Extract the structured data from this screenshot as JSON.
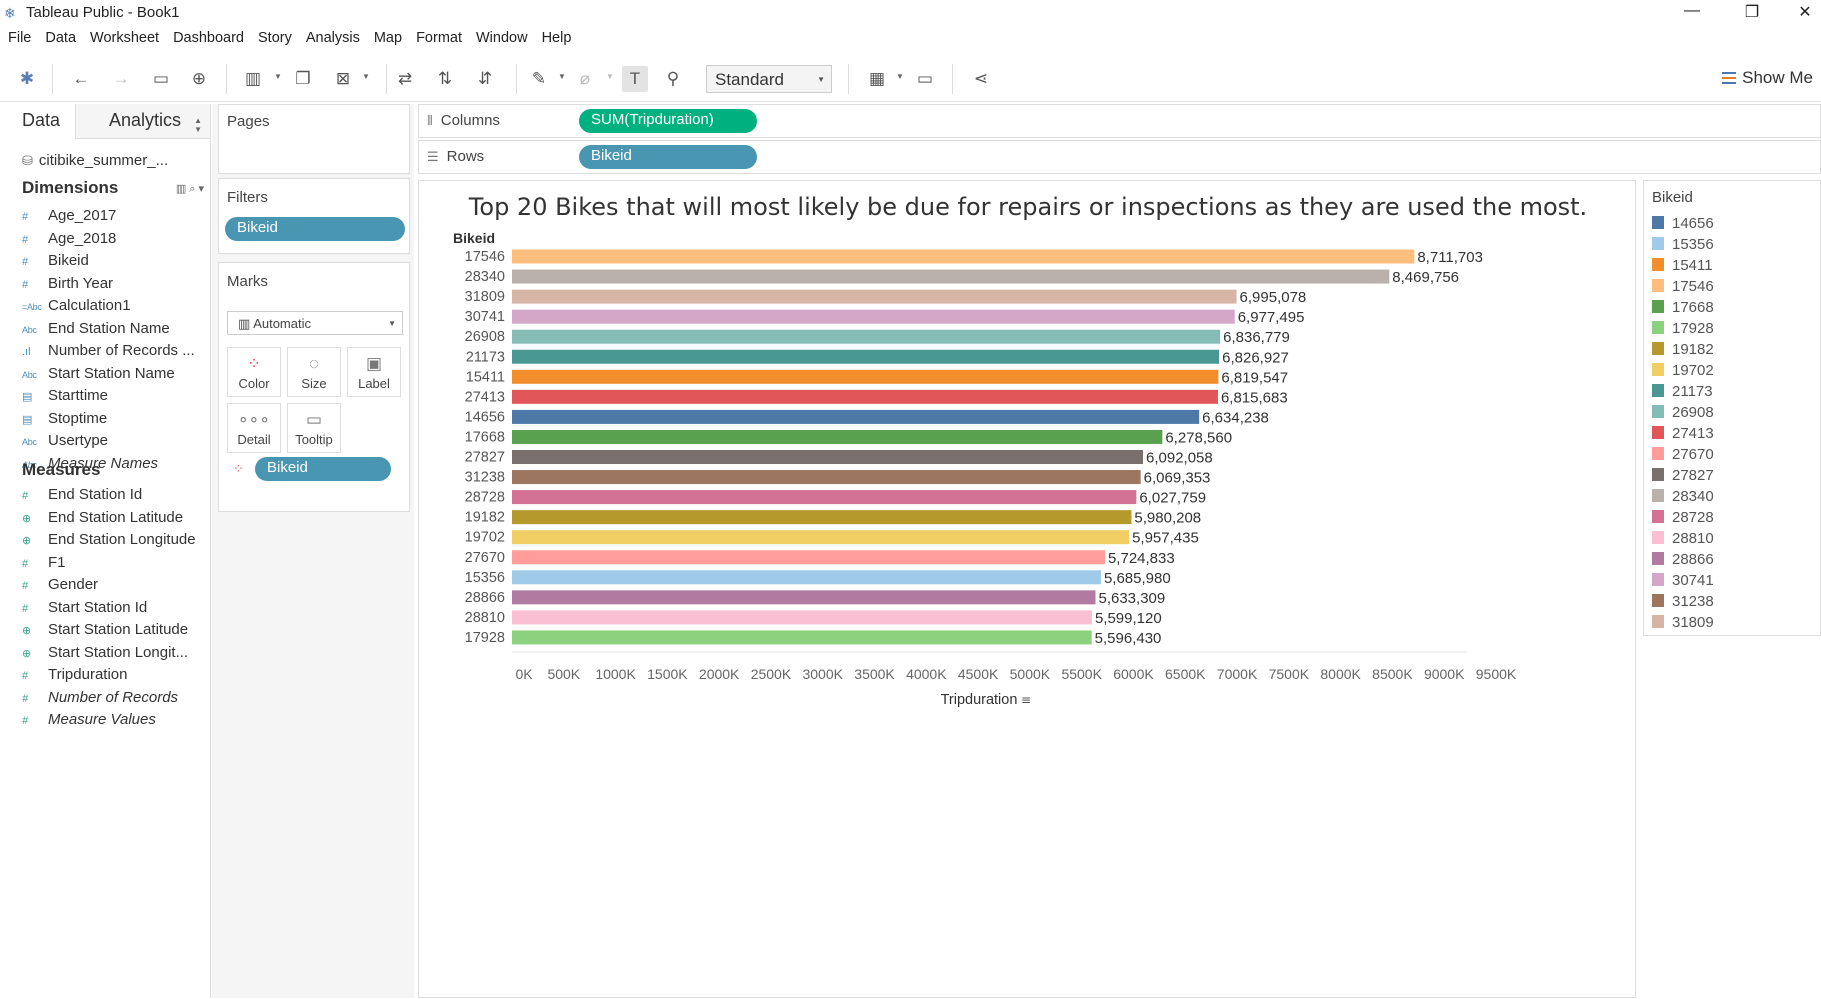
{
  "window": {
    "title": "Tableau Public - Book1",
    "minimize": "—",
    "restore": "❐",
    "close": "✕"
  },
  "menu": [
    "File",
    "Data",
    "Worksheet",
    "Dashboard",
    "Story",
    "Analysis",
    "Map",
    "Format",
    "Window",
    "Help"
  ],
  "toolbar": {
    "fit_mode": "Standard",
    "show_me": "Show Me"
  },
  "data_pane": {
    "tabs": [
      "Data",
      "Analytics"
    ],
    "data_source": "citibike_summer_...",
    "dimensions_label": "Dimensions",
    "dimensions": [
      {
        "name": "Age_2017",
        "icon": "number-dim"
      },
      {
        "name": "Age_2018",
        "icon": "number-dim"
      },
      {
        "name": "Bikeid",
        "icon": "number-dim"
      },
      {
        "name": "Birth Year",
        "icon": "number-dim"
      },
      {
        "name": "Calculation1",
        "icon": "calc-string"
      },
      {
        "name": "End Station Name",
        "icon": "string"
      },
      {
        "name": "Number of Records ...",
        "icon": "bar-dim"
      },
      {
        "name": "Start Station Name",
        "icon": "string"
      },
      {
        "name": "Starttime",
        "icon": "date"
      },
      {
        "name": "Stoptime",
        "icon": "date"
      },
      {
        "name": "Usertype",
        "icon": "string"
      },
      {
        "name": "Measure Names",
        "icon": "string",
        "italic": true
      }
    ],
    "measures_label": "Measures",
    "measures": [
      {
        "name": "End Station Id",
        "icon": "number"
      },
      {
        "name": "End Station Latitude",
        "icon": "geo"
      },
      {
        "name": "End Station Longitude",
        "icon": "geo"
      },
      {
        "name": "F1",
        "icon": "number"
      },
      {
        "name": "Gender",
        "icon": "number"
      },
      {
        "name": "Start Station Id",
        "icon": "number"
      },
      {
        "name": "Start Station Latitude",
        "icon": "geo"
      },
      {
        "name": "Start Station Longit...",
        "icon": "geo"
      },
      {
        "name": "Tripduration",
        "icon": "number"
      },
      {
        "name": "Number of Records",
        "icon": "number",
        "italic": true
      },
      {
        "name": "Measure Values",
        "icon": "number",
        "italic": true
      }
    ]
  },
  "shelves": {
    "pages_label": "Pages",
    "filters_label": "Filters",
    "filter_pill": "Bikeid",
    "marks_label": "Marks",
    "mark_type": "Automatic",
    "mark_buttons": [
      "Color",
      "Size",
      "Label",
      "Detail",
      "Tooltip"
    ],
    "marks_pill": "Bikeid",
    "columns_label": "Columns",
    "columns_pill": "SUM(Tripduration)",
    "rows_label": "Rows",
    "rows_pill": "Bikeid"
  },
  "legend": {
    "title": "Bikeid",
    "items": [
      {
        "label": "14656",
        "color": "#4e79a7"
      },
      {
        "label": "15356",
        "color": "#a0cbe8"
      },
      {
        "label": "15411",
        "color": "#f28e2b"
      },
      {
        "label": "17546",
        "color": "#ffbe7d"
      },
      {
        "label": "17668",
        "color": "#59a14f"
      },
      {
        "label": "17928",
        "color": "#8cd17d"
      },
      {
        "label": "19182",
        "color": "#b6992d"
      },
      {
        "label": "19702",
        "color": "#f1ce63"
      },
      {
        "label": "21173",
        "color": "#499894"
      },
      {
        "label": "26908",
        "color": "#86bcb6"
      },
      {
        "label": "27413",
        "color": "#e15759"
      },
      {
        "label": "27670",
        "color": "#ff9d9a"
      },
      {
        "label": "27827",
        "color": "#79706e"
      },
      {
        "label": "28340",
        "color": "#bab0ac"
      },
      {
        "label": "28728",
        "color": "#d37295"
      },
      {
        "label": "28810",
        "color": "#fabfd2"
      },
      {
        "label": "28866",
        "color": "#b07aa1"
      },
      {
        "label": "30741",
        "color": "#d4a6c8"
      },
      {
        "label": "31238",
        "color": "#9d7660"
      },
      {
        "label": "31809",
        "color": "#d7b5a6"
      }
    ]
  },
  "chart_data": {
    "type": "bar",
    "orientation": "horizontal",
    "title": "Top 20 Bikes that will most likely be due for repairs or inspections as they are used the most.",
    "row_header": "Bikeid",
    "xlabel": "Tripduration",
    "sort_icon": "sort-descending-icon",
    "xlim": [
      0,
      9500000
    ],
    "tick_values": [
      0,
      500000,
      1000000,
      1500000,
      2000000,
      2500000,
      3000000,
      3500000,
      4000000,
      4500000,
      5000000,
      5500000,
      6000000,
      6500000,
      7000000,
      7500000,
      8000000,
      8500000,
      9000000,
      9500000
    ],
    "tick_labels": [
      "0K",
      "500K",
      "1000K",
      "1500K",
      "2000K",
      "2500K",
      "3000K",
      "3500K",
      "4000K",
      "4500K",
      "5000K",
      "5500K",
      "6000K",
      "6500K",
      "7000K",
      "7500K",
      "8000K",
      "8500K",
      "9000K",
      "9500K"
    ],
    "categories": [
      "17546",
      "28340",
      "31809",
      "30741",
      "26908",
      "21173",
      "15411",
      "27413",
      "14656",
      "17668",
      "27827",
      "31238",
      "28728",
      "19182",
      "19702",
      "27670",
      "15356",
      "28866",
      "28810",
      "17928"
    ],
    "values": [
      8711703,
      8469756,
      6995078,
      6977495,
      6836779,
      6826927,
      6819547,
      6815683,
      6634238,
      6278560,
      6092058,
      6069353,
      6027759,
      5980208,
      5957435,
      5724833,
      5685980,
      5633309,
      5599120,
      5596430
    ],
    "value_labels": [
      "8,711,703",
      "8,469,756",
      "6,995,078",
      "6,977,495",
      "6,836,779",
      "6,826,927",
      "6,819,547",
      "6,815,683",
      "6,634,238",
      "6,278,560",
      "6,092,058",
      "6,069,353",
      "6,027,759",
      "5,980,208",
      "5,957,435",
      "5,724,833",
      "5,685,980",
      "5,633,309",
      "5,599,120",
      "5,596,430"
    ]
  }
}
